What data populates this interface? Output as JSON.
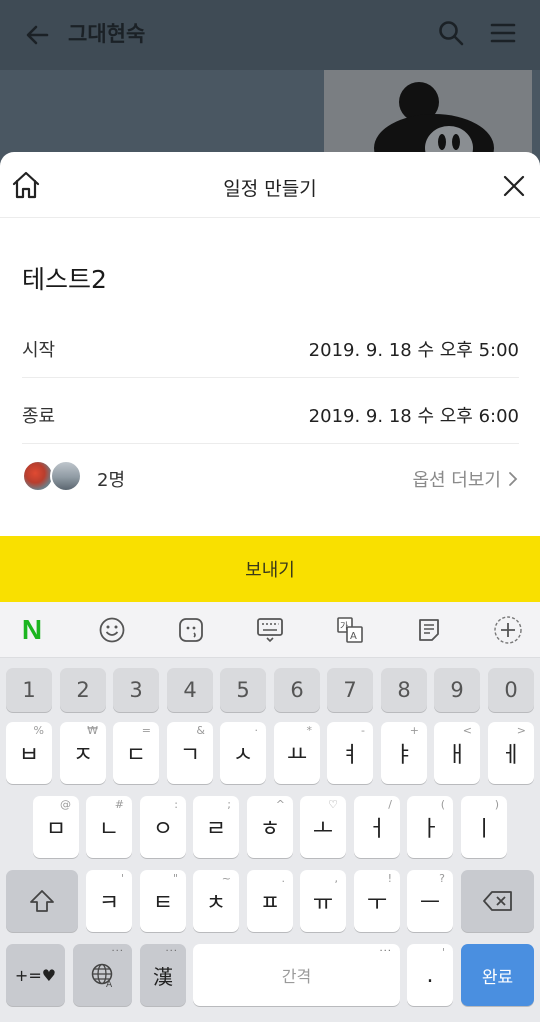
{
  "background": {
    "chat_title": "그대현숙"
  },
  "sheet": {
    "title": "일정 만들기",
    "event_title": "테스트2",
    "start": {
      "label": "시작",
      "value": "2019. 9. 18 수   오후 5:00"
    },
    "end": {
      "label": "종료",
      "value": "2019. 9. 18 수   오후 6:00"
    },
    "attendees": {
      "count": "2명",
      "more_options": "옵션 더보기"
    },
    "send_label": "보내기"
  },
  "keyboard": {
    "toolbar_icons": [
      "naver-icon",
      "emoji-icon",
      "emoticon-icon",
      "keyboard-icon",
      "translate-icon",
      "memo-icon",
      "add-icon"
    ],
    "naver_label": "N",
    "numbers": [
      "1",
      "2",
      "3",
      "4",
      "5",
      "6",
      "7",
      "8",
      "9",
      "0"
    ],
    "row1": [
      {
        "key": "ㅂ",
        "sub": "%"
      },
      {
        "key": "ㅈ",
        "sub": "₩"
      },
      {
        "key": "ㄷ",
        "sub": "="
      },
      {
        "key": "ㄱ",
        "sub": "&"
      },
      {
        "key": "ㅅ",
        "sub": "·"
      },
      {
        "key": "ㅛ",
        "sub": "*"
      },
      {
        "key": "ㅕ",
        "sub": "-"
      },
      {
        "key": "ㅑ",
        "sub": "+"
      },
      {
        "key": "ㅐ",
        "sub": "<"
      },
      {
        "key": "ㅔ",
        "sub": ">"
      }
    ],
    "row2": [
      {
        "key": "ㅁ",
        "sub": "@"
      },
      {
        "key": "ㄴ",
        "sub": "#"
      },
      {
        "key": "ㅇ",
        "sub": ":"
      },
      {
        "key": "ㄹ",
        "sub": ";"
      },
      {
        "key": "ㅎ",
        "sub": "^"
      },
      {
        "key": "ㅗ",
        "sub": "♡"
      },
      {
        "key": "ㅓ",
        "sub": "/"
      },
      {
        "key": "ㅏ",
        "sub": "("
      },
      {
        "key": "ㅣ",
        "sub": ")"
      }
    ],
    "row3": [
      {
        "key": "ㅋ",
        "sub": "'"
      },
      {
        "key": "ㅌ",
        "sub": "\""
      },
      {
        "key": "ㅊ",
        "sub": "~"
      },
      {
        "key": "ㅍ",
        "sub": "."
      },
      {
        "key": "ㅠ",
        "sub": ","
      },
      {
        "key": "ㅜ",
        "sub": "!"
      },
      {
        "key": "ㅡ",
        "sub": "?"
      }
    ],
    "symbols_label": "+=♥",
    "hanja_label": "漢",
    "space_label": "간격",
    "period_label": ".",
    "done_label": "완료"
  },
  "colors": {
    "send_button": "#f9e000",
    "done_key": "#4a8fe0",
    "naver_green": "#1bb520"
  }
}
